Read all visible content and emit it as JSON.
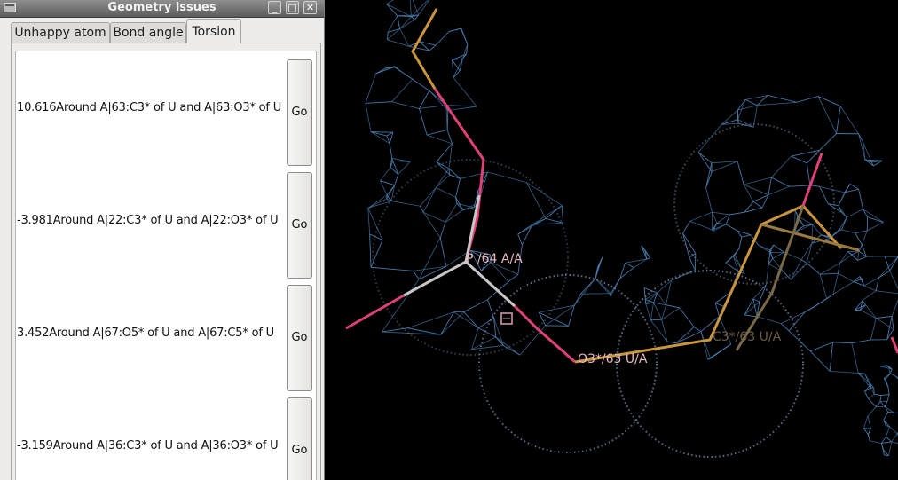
{
  "window": {
    "title": "Geometry issues",
    "controls": {
      "minimize": "_",
      "maximize": "□",
      "close": "✕"
    }
  },
  "tabs": [
    {
      "label": "Unhappy atom",
      "active": false
    },
    {
      "label": "Bond angle",
      "active": false
    },
    {
      "label": "Torsion",
      "active": true
    }
  ],
  "torsion_list": [
    {
      "value": "10.616",
      "description": "Around A|63:C3* of U and A|63:O3* of U",
      "button": "Go"
    },
    {
      "value": "-3.981",
      "description": "Around A|22:C3* of U and A|22:O3* of U",
      "button": "Go"
    },
    {
      "value": "3.452",
      "description": "Around A|67:O5* of U and A|67:C5* of U",
      "button": "Go"
    },
    {
      "value": "-3.159",
      "description": "Around A|36:C3* of U and A|36:O3* of U",
      "button": "Go"
    }
  ],
  "viewport": {
    "atom_labels": [
      "P  /64 A/A",
      "O3*/63 U/A",
      "C3*/63 U/A"
    ],
    "colors": {
      "background": "#000000",
      "density_mesh": "#4a7eb0",
      "dots": "#6f8aa8",
      "phosphate_bond": "#c8c8c8",
      "oxygen_bond": "#e0407a",
      "carbon_bond": "#c9953e"
    }
  }
}
